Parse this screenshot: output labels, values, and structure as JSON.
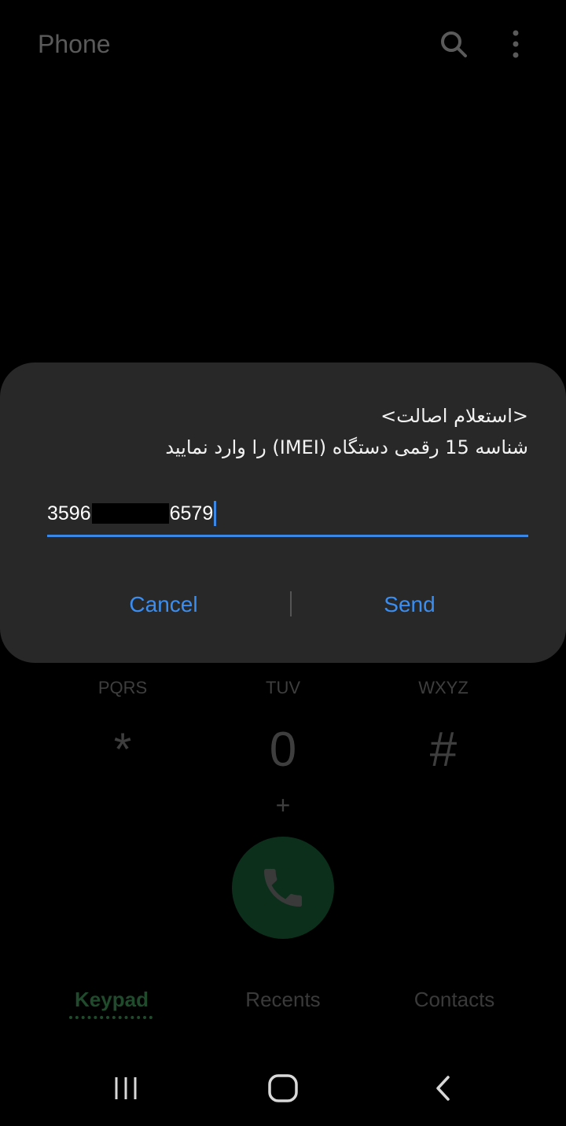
{
  "app": {
    "title": "Phone"
  },
  "header": {
    "search_icon": "search-icon",
    "more_icon": "more-vert-icon"
  },
  "dialog": {
    "message_line1": "<استعلام اصالت>",
    "message_line2": "شناسه 15 رقمی دستگاه (IMEI) را وارد نمایید",
    "input_value_prefix": "3596",
    "input_value_suffix": "6579",
    "cancel_label": "Cancel",
    "send_label": "Send",
    "accent_color": "#3b8ef0"
  },
  "keypad": {
    "keys": [
      {
        "main": "*",
        "letters": "PQRS"
      },
      {
        "main": "0",
        "letters": "TUV",
        "sub": "+"
      },
      {
        "main": "#",
        "letters": "WXYZ"
      }
    ],
    "call_icon": "phone-icon",
    "call_color": "#0c2f1c"
  },
  "tabs": [
    {
      "label": "Keypad",
      "active": true
    },
    {
      "label": "Recents",
      "active": false
    },
    {
      "label": "Contacts",
      "active": false
    }
  ],
  "navbar": {
    "recents_icon": "recent-apps-icon",
    "home_icon": "home-icon",
    "back_icon": "back-icon"
  }
}
